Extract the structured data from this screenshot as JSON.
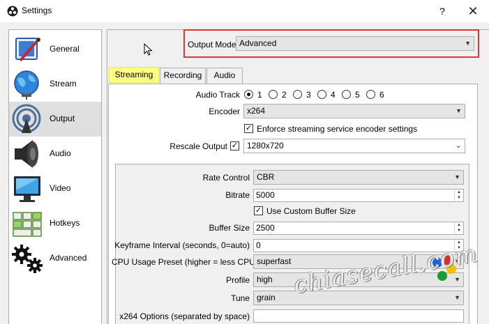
{
  "window": {
    "title": "Settings",
    "help_label": "?",
    "close_label": "✕"
  },
  "sidebar": {
    "items": [
      {
        "label": "General",
        "icon": "general-icon"
      },
      {
        "label": "Stream",
        "icon": "globe-icon"
      },
      {
        "label": "Output",
        "icon": "output-icon",
        "active": true
      },
      {
        "label": "Audio",
        "icon": "speaker-icon"
      },
      {
        "label": "Video",
        "icon": "monitor-icon"
      },
      {
        "label": "Hotkeys",
        "icon": "keyboard-icon"
      },
      {
        "label": "Advanced",
        "icon": "gears-icon"
      }
    ]
  },
  "output_mode": {
    "label": "Output Mode",
    "value": "Advanced"
  },
  "tabs": [
    {
      "label": "Streaming",
      "active": true
    },
    {
      "label": "Recording"
    },
    {
      "label": "Audio"
    }
  ],
  "streaming": {
    "audio_track": {
      "label": "Audio Track",
      "options": [
        "1",
        "2",
        "3",
        "4",
        "5",
        "6"
      ],
      "selected": "1"
    },
    "encoder": {
      "label": "Encoder",
      "value": "x264"
    },
    "enforce": {
      "label": "Enforce streaming service encoder settings",
      "checked": true
    },
    "rescale": {
      "label": "Rescale Output",
      "checked": true,
      "value": "1280x720"
    },
    "rate_control": {
      "label": "Rate Control",
      "value": "CBR"
    },
    "bitrate": {
      "label": "Bitrate",
      "value": "5000"
    },
    "custom_buffer": {
      "label": "Use Custom Buffer Size",
      "checked": true
    },
    "buffer_size": {
      "label": "Buffer Size",
      "value": "2500"
    },
    "keyframe": {
      "label": "Keyframe Interval (seconds, 0=auto)",
      "value": "0"
    },
    "cpu_preset": {
      "label": "CPU Usage Preset (higher = less CPU)",
      "value": "superfast"
    },
    "profile": {
      "label": "Profile",
      "value": "high"
    },
    "tune": {
      "label": "Tune",
      "value": "grain"
    },
    "x264_options": {
      "label": "x264 Options (separated by space)",
      "value": ""
    }
  },
  "watermark": {
    "text": "chiasecall.com"
  },
  "colors": {
    "highlight_red": "#e0333a",
    "tab_yellow": "#ffff7f",
    "selected_nav": "#dfdfdf"
  }
}
